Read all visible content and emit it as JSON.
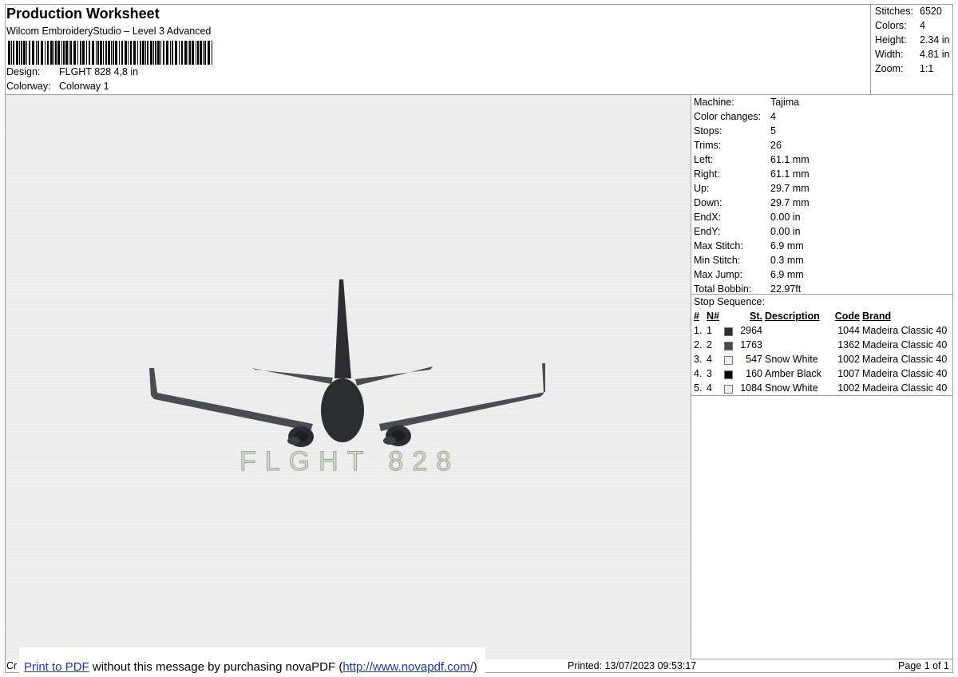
{
  "header": {
    "title": "Production Worksheet",
    "software": "Wilcom EmbroideryStudio – Level 3 Advanced",
    "design_label": "Design:",
    "design_value": "FLGHT 828 4,8 in",
    "colorway_label": "Colorway:",
    "colorway_value": "Colorway 1"
  },
  "summary": [
    {
      "label": "Stitches:",
      "value": "6520"
    },
    {
      "label": "Colors:",
      "value": "4"
    },
    {
      "label": "Height:",
      "value": "2.34 in"
    },
    {
      "label": "Width:",
      "value": "4.81 in"
    },
    {
      "label": "Zoom:",
      "value": "1:1"
    }
  ],
  "details": [
    {
      "label": "Machine:",
      "value": "Tajima"
    },
    {
      "label": "Color changes:",
      "value": "4"
    },
    {
      "label": "Stops:",
      "value": "5"
    },
    {
      "label": "Trims:",
      "value": "26"
    },
    {
      "label": "Left:",
      "value": "61.1 mm"
    },
    {
      "label": "Right:",
      "value": "61.1 mm"
    },
    {
      "label": "Up:",
      "value": "29.7 mm"
    },
    {
      "label": "Down:",
      "value": "29.7 mm"
    },
    {
      "label": "EndX:",
      "value": "0.00 in"
    },
    {
      "label": "EndY:",
      "value": "0.00 in"
    },
    {
      "label": "Max Stitch:",
      "value": "6.9 mm"
    },
    {
      "label": "Min Stitch:",
      "value": "0.3 mm"
    },
    {
      "label": "Max Jump:",
      "value": "6.9 mm"
    },
    {
      "label": "Total Bobbin:",
      "value": "22.97ft"
    }
  ],
  "stops": {
    "label": "Stop Sequence:",
    "columns": {
      "num": "#",
      "n": "N#",
      "st": "St.",
      "desc": "Description",
      "code": "Code",
      "brand": "Brand"
    },
    "rows": [
      {
        "num": "1.",
        "n": "1",
        "color": "#2b2d30",
        "st": "2964",
        "desc": "",
        "code": "1044",
        "brand": "Madeira Classic 40"
      },
      {
        "num": "2.",
        "n": "2",
        "color": "#4a4c52",
        "st": "1763",
        "desc": "",
        "code": "1362",
        "brand": "Madeira Classic 40"
      },
      {
        "num": "3.",
        "n": "4",
        "color": "#eceef6",
        "st": "547",
        "desc": "Snow White",
        "code": "1002",
        "brand": "Madeira Classic 40"
      },
      {
        "num": "4.",
        "n": "3",
        "color": "#050505",
        "st": "160",
        "desc": "Amber Black",
        "code": "1007",
        "brand": "Madeira Classic 40"
      },
      {
        "num": "5.",
        "n": "4",
        "color": "#eceef6",
        "st": "1084",
        "desc": "Snow White",
        "code": "1002",
        "brand": "Madeira Classic 40"
      }
    ]
  },
  "design": {
    "text": "FLGHT 828",
    "canvas_color": "#ebebeb",
    "fuselage_color": "#2b2d30",
    "wing_color": "#4a4c52",
    "text_color": "#d8ddd2"
  },
  "footer": {
    "cr": "Cr",
    "printed": "Printed: 13/07/2023 09:53:17",
    "page": "Page 1 of 1"
  },
  "nova": {
    "link_text": "Print to PDF",
    "message": " without this message by purchasing novaPDF (",
    "url_text": "http://www.novapdf.com/",
    "close": ")"
  }
}
